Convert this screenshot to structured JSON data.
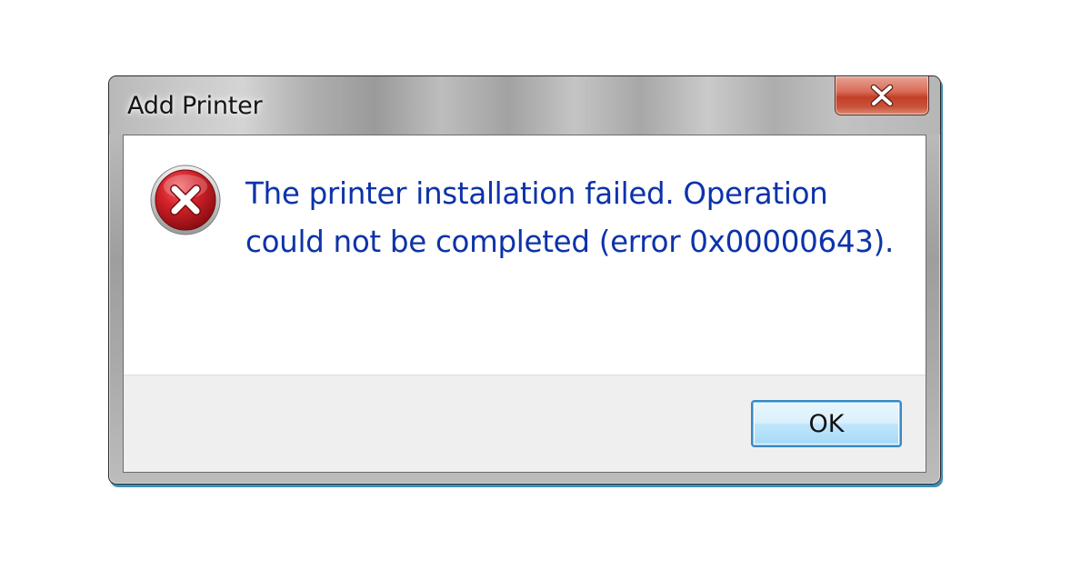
{
  "window": {
    "title": "Add Printer"
  },
  "message": {
    "text": "The printer installation failed. Operation could not be completed (error 0x00000643)."
  },
  "buttons": {
    "ok_label": "OK"
  },
  "icons": {
    "close": "close-icon",
    "error": "error-icon"
  },
  "colors": {
    "message_text": "#0c33a9",
    "close_button": "#c23f27",
    "error_icon": "#c8141c",
    "ok_button_border": "#3a89c4",
    "footer_background": "#efefef"
  }
}
